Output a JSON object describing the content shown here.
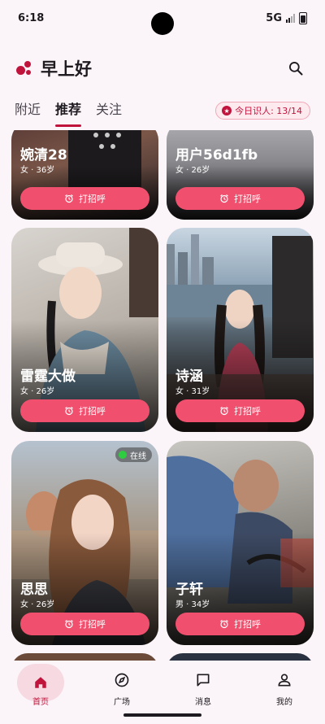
{
  "status": {
    "time": "6:18",
    "network": "5G"
  },
  "header": {
    "greeting": "早上好"
  },
  "tabs": [
    {
      "label": "附近",
      "active": false
    },
    {
      "label": "推荐",
      "active": true
    },
    {
      "label": "关注",
      "active": false
    }
  ],
  "quota": {
    "label": "今日识人: 13/14"
  },
  "cards": [
    {
      "name": "婉清28",
      "meta": "女 · 36岁",
      "button": "打招呼"
    },
    {
      "name": "用户56d1fb",
      "meta": "女 · 26岁",
      "button": "打招呼"
    },
    {
      "name": "雷霆大做",
      "meta": "女 · 26岁",
      "button": "打招呼"
    },
    {
      "name": "诗涵",
      "meta": "女 · 31岁",
      "button": "打招呼"
    },
    {
      "name": "思思",
      "meta": "女 · 26岁",
      "button": "打招呼",
      "badge": "在线"
    },
    {
      "name": "子轩",
      "meta": "男 · 34岁",
      "button": "打招呼"
    }
  ],
  "nav": [
    {
      "label": "首页",
      "icon": "home-icon",
      "active": true
    },
    {
      "label": "广场",
      "icon": "compass-icon",
      "active": false
    },
    {
      "label": "消息",
      "icon": "message-icon",
      "active": false
    },
    {
      "label": "我的",
      "icon": "person-icon",
      "active": false
    }
  ],
  "colors": {
    "accent": "#c0143c",
    "button": "#f0506e",
    "background": "#fbf4f8"
  }
}
